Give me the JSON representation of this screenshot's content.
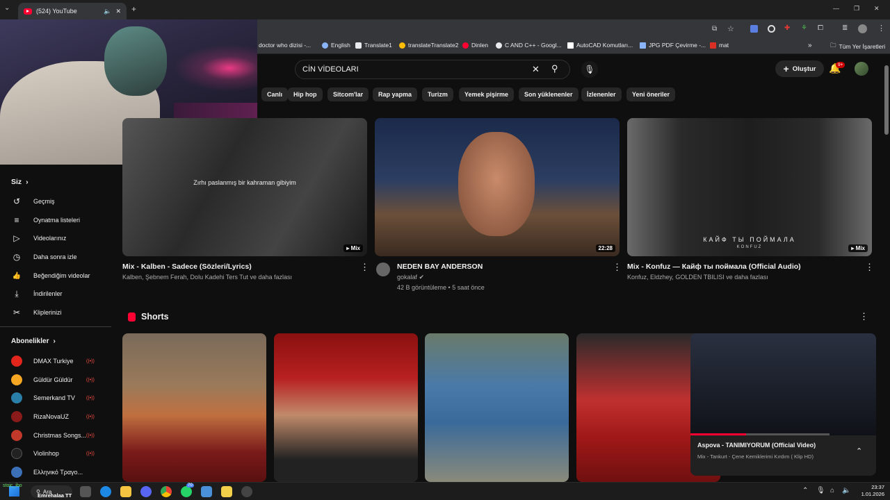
{
  "browser": {
    "tab_title": "(524) YouTube",
    "new_tab": "+",
    "window_controls": [
      "—",
      "❐",
      "✕"
    ]
  },
  "bookmarks": [
    {
      "label": "doctor who dizisi -...",
      "color": "#5f6368"
    },
    {
      "label": "English",
      "color": "#8ab4f8"
    },
    {
      "label": "Translate1",
      "color": "#e8eaed"
    },
    {
      "label": "translateTranslate2",
      "color": "#fbbc04"
    },
    {
      "label": "Dinlen",
      "color": "#ff0033"
    },
    {
      "label": "C AND C++ - Googl...",
      "color": "#e8eaed"
    },
    {
      "label": "AutoCAD Komutları...",
      "color": "#ffffff"
    },
    {
      "label": "JPG PDF Çevirme -...",
      "color": "#8ab4f8"
    },
    {
      "label": "mat",
      "color": "#d93025"
    },
    {
      "label": "Tüm Yer İşaretleri",
      "color": "#e8eaed"
    }
  ],
  "search": {
    "query": "CİN VİDEOLARI"
  },
  "header": {
    "create_label": "Oluştur",
    "notif_count": "9+"
  },
  "chips": [
    "Canlı",
    "Hip hop",
    "Sitcom'lar",
    "Rap yapma",
    "Turizm",
    "Yemek pişirme",
    "Son yüklenenler",
    "İzlenenler",
    "Yeni öneriler"
  ],
  "sidebar": {
    "you_heading": "Siz",
    "you_items": [
      {
        "label": "Geçmiş",
        "icon": "history-icon",
        "glyph": "↺"
      },
      {
        "label": "Oynatma listeleri",
        "icon": "playlist-icon",
        "glyph": "≡"
      },
      {
        "label": "Videolarınız",
        "icon": "your-videos-icon",
        "glyph": "▷"
      },
      {
        "label": "Daha sonra izle",
        "icon": "clock-icon",
        "glyph": "◷"
      },
      {
        "label": "Beğendiğim videolar",
        "icon": "like-icon",
        "glyph": "👍"
      },
      {
        "label": "İndirilenler",
        "icon": "download-icon",
        "glyph": "⤓"
      },
      {
        "label": "Kliplerinizi",
        "icon": "scissors-icon",
        "glyph": "✂"
      }
    ],
    "subs_heading": "Abonelikler",
    "subs": [
      {
        "label": "DMAX Turkiye",
        "color": "#e2261c"
      },
      {
        "label": "Güldür Güldür",
        "color": "#f5a623"
      },
      {
        "label": "Semerkand TV",
        "color": "#2a7fa8"
      },
      {
        "label": "RizaNovaUZ",
        "color": "#8b1a1a"
      },
      {
        "label": "Christmas Songs...",
        "color": "#c0392b"
      },
      {
        "label": "Violinhop",
        "color": "#222222"
      },
      {
        "label": "Ελληνικό Τραγο...",
        "color": "#3b6fb6"
      }
    ]
  },
  "videos": [
    {
      "title": "Mix - Kalben - Sadece (Sözleri/Lyrics)",
      "meta": "Kalben, Şebnem Ferah, Dolu Kadehi Ters Tut ve daha fazlası",
      "badge": "Mix",
      "caption": "Zırhı paslanmış bir kahraman gibiyim"
    },
    {
      "title": "NEDEN BAY ANDERSON",
      "channel": "gokalaf",
      "meta": "42 B görüntüleme • 5 saat önce",
      "badge": "22:28"
    },
    {
      "title": "Mix - Konfuz — Кайф ты поймала (Official Audio)",
      "meta": "Konfuz, Eldzhey, GOLDEN TBILISI ve daha fazlası",
      "badge": "Mix",
      "overlay_title": "КАЙФ ТЫ ПОЙМАЛА",
      "overlay_sub": "KONFUZ"
    }
  ],
  "shorts_heading": "Shorts",
  "miniplayer": {
    "title": "Aspova - TANIMIYORUM (Official Video)",
    "subtitle": "Mix - Tankurt - Çene Kemiklerimi Kırdım ( Klip HD)",
    "progress": 0.4
  },
  "taskbar": {
    "search": "Ara",
    "streamer": "Emrehalaa TT",
    "streamer_small": "stoic_ibo",
    "whatsapp_badge": "70",
    "time": "23:37",
    "date": "1.01.2026"
  },
  "colors": {
    "bg": "#0f0f0f",
    "brand_red": "#ff0033",
    "chip_bg": "#272727"
  }
}
